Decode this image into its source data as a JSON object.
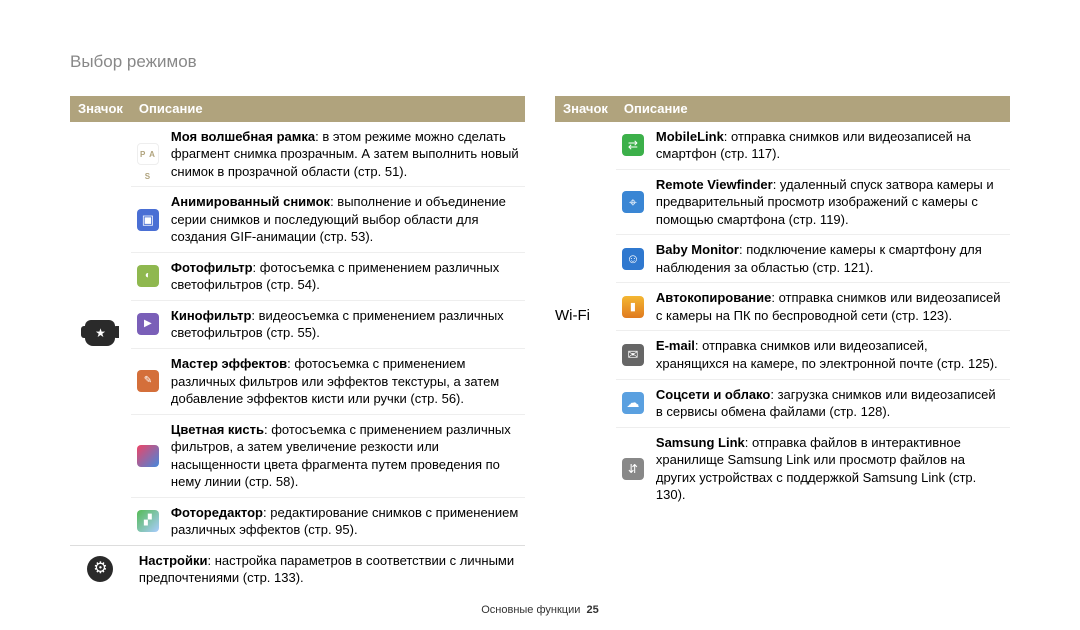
{
  "page_title": "Выбор режимов",
  "headers": {
    "icon": "Значок",
    "desc": "Описание"
  },
  "left": {
    "magic": {
      "frame_t": "Моя волшебная рамка",
      "frame_d": ": в этом режиме можно сделать фрагмент снимка прозрачным. А затем выполнить новый снимок в прозрачной области (стр. 51).",
      "gif_t": "Анимированный снимок",
      "gif_d": ": выполнение и объединение серии снимков и последующий выбор области для создания GIF-анимации (стр. 53).",
      "pfilter_t": "Фотофильтр",
      "pfilter_d": ": фотосъемка с применением различных светофильтров (стр. 54).",
      "mfilter_t": "Кинофильтр",
      "mfilter_d": ": видеосъемка с применением различных светофильтров (стр. 55).",
      "effects_t": "Мастер эффектов",
      "effects_d": ": фотосъемка с применением различных фильтров или эффектов текстуры, а затем добавление эффектов кисти или ручки (стр. 56).",
      "brush_t": "Цветная кисть",
      "brush_d": ": фотосъемка с применением различных фильтров, а затем увеличение резкости или насыщенности цвета фрагмента путем проведения по нему линии (стр. 58).",
      "editor_t": "Фоторедактор",
      "editor_d": ": редактирование снимков с применением различных эффектов (стр. 95)."
    },
    "settings_t": "Настройки",
    "settings_d": ": настройка параметров в соответствии с личными предпочтениями (стр. 133).",
    "pas": "P A S"
  },
  "right": {
    "wifi_label": "Wi-Fi",
    "ml_t": "MobileLink",
    "ml_d": ": отправка снимков или видеозаписей на смартфон (стр. 117).",
    "rvf_t": "Remote Viewfinder",
    "rvf_d": ": удаленный спуск затвора камеры и предварительный просмотр изображений с камеры с помощью смартфона (стр. 119).",
    "baby_t": "Baby Monitor",
    "baby_d": ": подключение камеры к смартфону для наблюдения за областью (стр. 121).",
    "auto_t": "Автокопирование",
    "auto_d": ": отправка снимков или видеозаписей с камеры на ПК по беспроводной сети (стр. 123).",
    "email_t": "E-mail",
    "email_d": ": отправка снимков или видеозаписей, хранящихся на камере, по электронной почте (стр. 125).",
    "cloud_t": "Соцсети и облако",
    "cloud_d": ": загрузка снимков или видеозаписей в сервисы обмена файлами (стр. 128).",
    "slink_t": "Samsung Link",
    "slink_d": ": отправка файлов в интерактивное хранилище Samsung Link или просмотр файлов на других устройствах с поддержкой Samsung Link (стр. 130)."
  },
  "footer": {
    "label": "Основные функции",
    "page": "25"
  }
}
